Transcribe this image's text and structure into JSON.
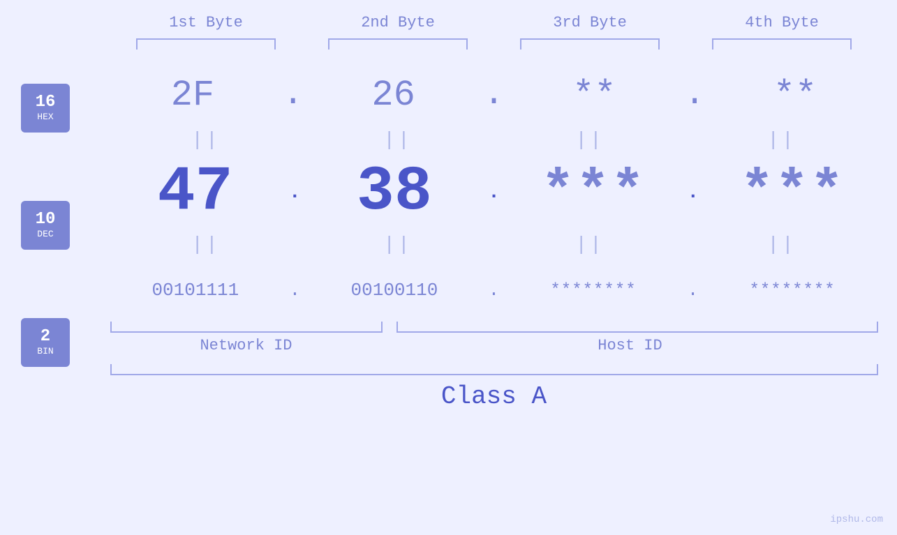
{
  "header": {
    "bytes": [
      "1st Byte",
      "2nd Byte",
      "3rd Byte",
      "4th Byte"
    ]
  },
  "bases": [
    {
      "number": "16",
      "label": "HEX"
    },
    {
      "number": "10",
      "label": "DEC"
    },
    {
      "number": "2",
      "label": "BIN"
    }
  ],
  "hex_row": {
    "byte1": "2F",
    "byte2": "26",
    "byte3": "**",
    "byte4": "**",
    "separator": "."
  },
  "dec_row": {
    "byte1": "47",
    "byte2": "38",
    "byte3": "***",
    "byte4": "***",
    "separator": "."
  },
  "bin_row": {
    "byte1": "00101111",
    "byte2": "00100110",
    "byte3": "********",
    "byte4": "********",
    "separator": "."
  },
  "equals_symbol": "||",
  "network_id_label": "Network ID",
  "host_id_label": "Host ID",
  "class_label": "Class A",
  "watermark": "ipshu.com"
}
